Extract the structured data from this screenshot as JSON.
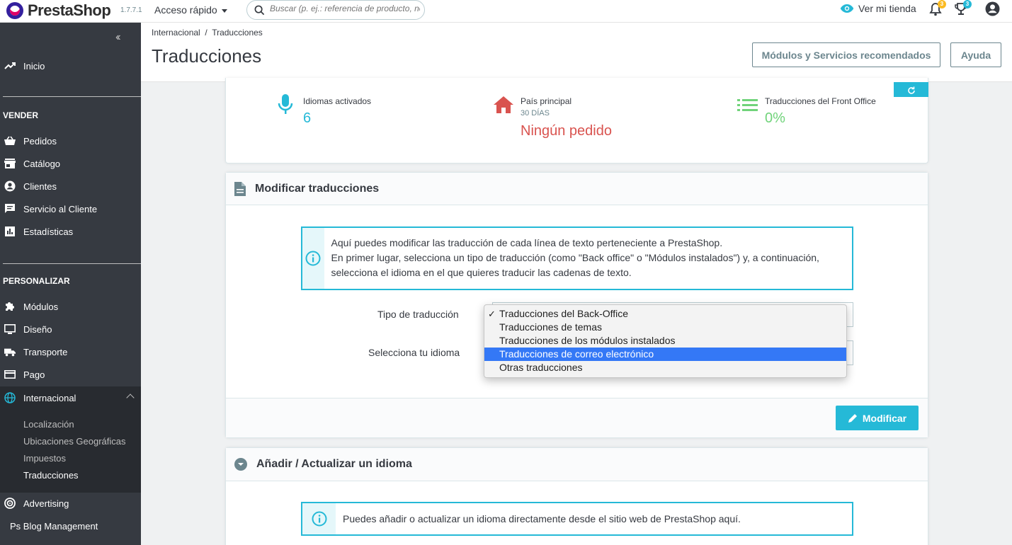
{
  "topbar": {
    "brand": "PrestaShop",
    "version": "1.7.7.1",
    "quick_access": "Acceso rápido",
    "search_placeholder": "Buscar (p. ej.: referencia de producto, nombre de cliente…)",
    "view_shop": "Ver mi tienda",
    "notifications_count": "3",
    "orders_count": "3"
  },
  "sidebar": {
    "home": "Inicio",
    "section_sell": "VENDER",
    "sell_items": [
      "Pedidos",
      "Catálogo",
      "Clientes",
      "Servicio al Cliente",
      "Estadísticas"
    ],
    "section_customize": "PERSONALIZAR",
    "customize_items": [
      "Módulos",
      "Diseño",
      "Transporte",
      "Pago"
    ],
    "international": "Internacional",
    "international_sub": [
      "Localización",
      "Ubicaciones Geográficas",
      "Impuestos",
      "Traducciones"
    ],
    "advertising": "Advertising",
    "blog": "Ps Blog Management"
  },
  "header": {
    "breadcrumb_parent": "Internacional",
    "breadcrumb_current": "Traducciones",
    "title": "Traducciones",
    "recommended_button": "Módulos y Servicios recomendados",
    "help_button": "Ayuda"
  },
  "kpis": {
    "languages_label": "Idiomas activados",
    "languages_value": "6",
    "country_label": "País principal",
    "country_sub": "30 DÍAS",
    "country_value": "Ningún pedido",
    "front_label": "Traducciones del Front Office",
    "front_value": "0%"
  },
  "modify_panel": {
    "title": "Modificar traducciones",
    "info_line1": "Aquí puedes modificar las traducción de cada línea de texto perteneciente a PrestaShop.",
    "info_line2": "En primer lugar, selecciona un tipo de traducción (como \"Back office\" o \"Módulos instalados\") y, a continuación, selecciona el idioma en el que quieres traducir las cadenas de texto.",
    "type_label": "Tipo de traducción",
    "language_label": "Selecciona tu idioma",
    "type_options": [
      "Traducciones del Back-Office",
      "Traducciones de temas",
      "Traducciones de los módulos instalados",
      "Traducciones de correo electrónico",
      "Otras traducciones"
    ],
    "checked_option": "✓",
    "modify_button": "Modificar"
  },
  "add_panel": {
    "title": "Añadir / Actualizar un idioma",
    "info": "Puedes añadir o actualizar un idioma directamente desde el sitio web de PrestaShop aquí."
  },
  "colors": {
    "accent": "#25b9d7",
    "sidebar": "#363a41",
    "danger": "#d9534f",
    "success": "#70d37a",
    "highlight": "#3478f6"
  }
}
